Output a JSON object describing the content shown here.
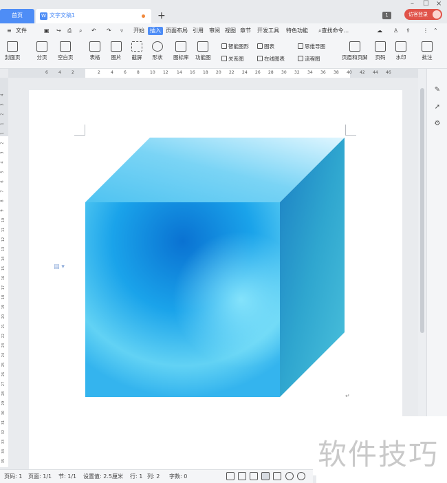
{
  "titlebar": {
    "home_tab": "首页",
    "doc_tab": "文字文稿1",
    "new_tab": "+",
    "window_count": "1",
    "login": "访客登录",
    "minimize": "–",
    "maximize": "☐",
    "close": "×"
  },
  "menu": {
    "file": "文件",
    "items": [
      "开始",
      "插入",
      "页面布局",
      "引用",
      "审阅",
      "视图",
      "章节",
      "开发工具",
      "特色功能"
    ],
    "search": "查找命令..."
  },
  "ribbon": {
    "cover": "封面页",
    "page_break": "分页",
    "blank_page": "空白页",
    "table": "表格",
    "picture": "图片",
    "screenshot": "截屏",
    "shape": "形状",
    "icon_lib": "图标库",
    "function_chart": "功能图",
    "smart_shape": "智能图形",
    "chart": "图表",
    "mind_map": "思维导图",
    "relation_chart": "关系图",
    "online_chart": "在线图表",
    "flowchart": "流程图",
    "header_footer": "页眉和页脚",
    "page_number": "页码",
    "watermark": "水印",
    "comment": "批注"
  },
  "ruler": {
    "ticks": [
      "6",
      "4",
      "2",
      "2",
      "4",
      "6",
      "8",
      "10",
      "12",
      "14",
      "16",
      "18",
      "20",
      "22",
      "24",
      "26",
      "28",
      "30",
      "32",
      "34",
      "36",
      "38",
      "40",
      "42",
      "44",
      "46"
    ]
  },
  "vruler": {
    "ticks": [
      "4",
      "3",
      "2",
      "1",
      "1",
      "2",
      "3",
      "4",
      "5",
      "6",
      "7",
      "8",
      "9",
      "10",
      "11",
      "12",
      "13",
      "14",
      "15",
      "16",
      "17",
      "18",
      "19",
      "20",
      "21",
      "22",
      "23",
      "24",
      "25",
      "26",
      "27",
      "28",
      "29",
      "30",
      "31",
      "32",
      "33",
      "34",
      "35"
    ]
  },
  "document": {
    "paragraph_mark": "↵",
    "cube_colors": {
      "front": "#1fa6ea",
      "top": "#6fd0f3",
      "side": "#2aa0cf"
    }
  },
  "status": {
    "page_num": "页码: 1",
    "pages": "页面: 1/1",
    "section": "节: 1/1",
    "setting": "设置值: 2.5厘米",
    "row": "行: 1",
    "col": "列: 2",
    "words": "字数: 0"
  },
  "overlay": {
    "watermark_text": "软件技巧"
  }
}
